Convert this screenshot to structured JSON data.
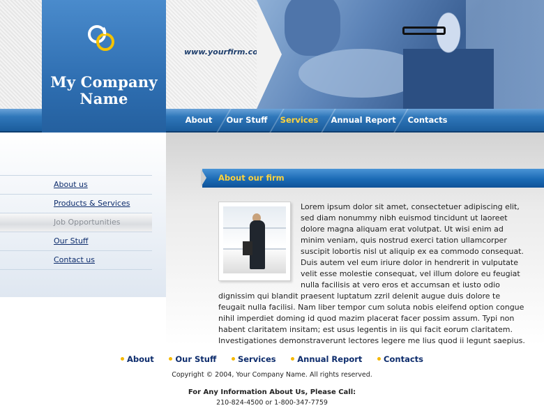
{
  "header": {
    "url": "www.yourfirm.com",
    "company_line1": "My Company",
    "company_line2": "Name"
  },
  "nav": {
    "items": [
      {
        "label": "About"
      },
      {
        "label": "Our Stuff"
      },
      {
        "label": "Services",
        "active": true
      },
      {
        "label": "Annual Report"
      },
      {
        "label": "Contacts"
      }
    ]
  },
  "sidebar": {
    "items": [
      {
        "label": "About us"
      },
      {
        "label": "Products & Services"
      },
      {
        "label": "Job Opportunities",
        "active": true
      },
      {
        "label": "Our Stuff"
      },
      {
        "label": "Contact us"
      }
    ]
  },
  "main": {
    "section_title": "About our firm",
    "paragraph": "Lorem ipsum dolor sit amet, consectetuer adipiscing elit, sed diam nonummy nibh euismod tincidunt ut laoreet dolore magna aliquam erat volutpat. Ut wisi enim ad minim veniam, quis nostrud exerci tation ullamcorper suscipit lobortis nisl ut aliquip ex ea commodo consequat. Duis autem vel eum iriure dolor in hendrerit in vulputate velit esse molestie consequat, vel illum dolore eu feugiat nulla facilisis at vero eros et accumsan et iusto odio dignissim qui blandit praesent luptatum zzril delenit augue duis dolore te feugait nulla facilisi. Nam liber tempor cum soluta nobis eleifend option congue nihil imperdiet doming id quod mazim placerat facer possim assum. Typi non habent claritatem insitam; est usus legentis in iis qui facit eorum claritatem. Investigationes demonstraverunt lectores legere me lius quod ii legunt saepius."
  },
  "footer": {
    "links": [
      {
        "label": "About"
      },
      {
        "label": "Our Stuff"
      },
      {
        "label": "Services"
      },
      {
        "label": "Annual Report"
      },
      {
        "label": "Contacts"
      }
    ],
    "copyright": "Copyright © 2004, Your Company Name. All rights reserved.",
    "call_label": "For Any Information About Us, Please Call:",
    "phones": "210-824-4500 or 1-800-347-7759"
  },
  "colors": {
    "accent_blue": "#2f6fb2",
    "highlight_yellow": "#ffd33d",
    "link_navy": "#0d2c6c"
  },
  "icons": {
    "logo": "interlocking-rings-icon",
    "footer_bullet": "yellow-dot-icon"
  }
}
